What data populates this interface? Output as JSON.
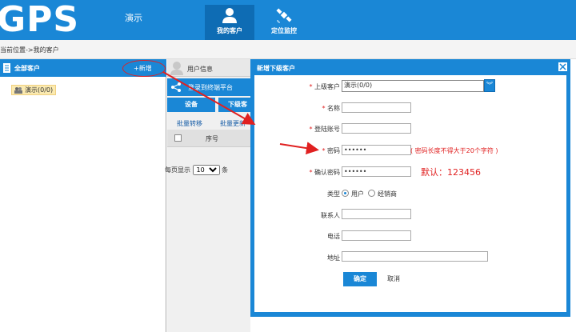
{
  "header": {
    "logo": "GPS",
    "company": "演示",
    "nav": [
      {
        "label": "我的客户",
        "icon": "user-icon",
        "active": true
      },
      {
        "label": "定位监控",
        "icon": "satellite-icon",
        "active": false
      }
    ]
  },
  "breadcrumb": "当前位置->我的客户",
  "sidebar": {
    "title": "全部客户",
    "add_label": "+新增",
    "tree": [
      {
        "label": "演示(0/0)"
      }
    ]
  },
  "middle": {
    "user_info_tab": "用户信息",
    "login_button": "登录到终端平台",
    "device_button": "设备",
    "distribute_button": "下级客",
    "batch_move": "批量转移",
    "batch_update": "批量更新",
    "column_seq": "序号",
    "per_page_label": "每页显示",
    "per_page_value": "10",
    "per_page_unit": "条"
  },
  "modal": {
    "title": "新增下级客户",
    "fields": {
      "parent_label": "上级客户",
      "parent_value": "演示(0/0)",
      "name_label": "名称",
      "name_value": "",
      "account_label": "登陆账号",
      "account_value": "",
      "password_label": "密码",
      "password_value": "••••••",
      "password_hint": "( 密码长度不得大于20个字符 )",
      "confirm_label": "确认密码",
      "confirm_value": "••••••",
      "default_note": "默认：123456",
      "type_label": "类型",
      "type_option_user": "用户",
      "type_option_dealer": "经销商",
      "contact_label": "联系人",
      "contact_value": "",
      "phone_label": "电话",
      "phone_value": "",
      "address_label": "地址",
      "address_value": ""
    },
    "ok_label": "确定",
    "cancel_label": "取消"
  },
  "colors": {
    "primary": "#1a87d6",
    "annotation_red": "#e02020"
  }
}
